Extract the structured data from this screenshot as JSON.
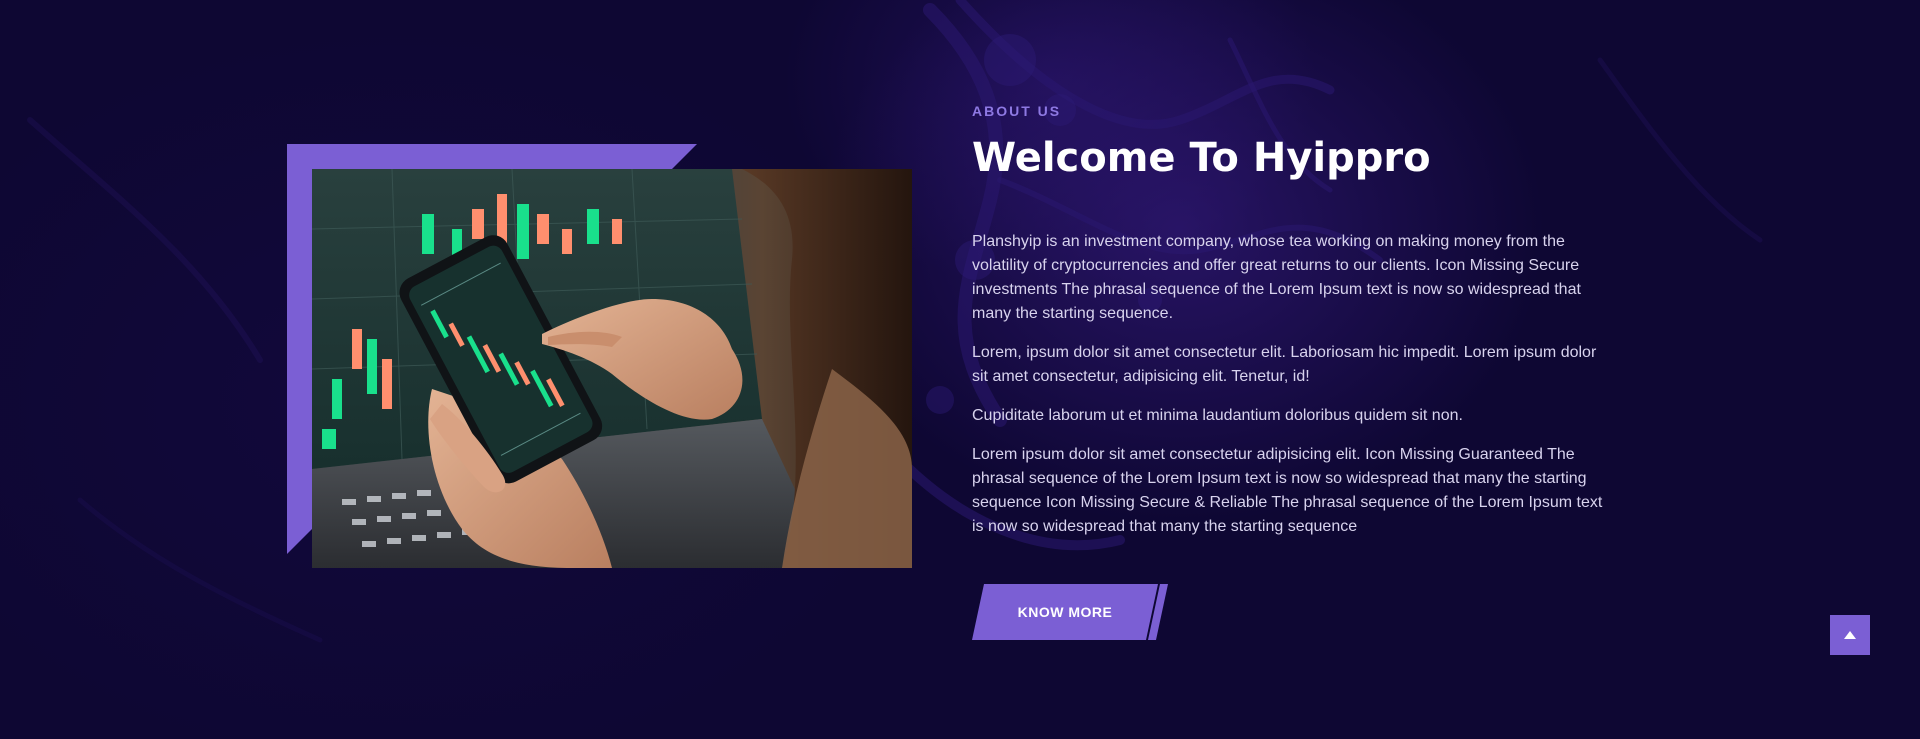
{
  "about": {
    "eyebrow": "ABOUT US",
    "title": "Welcome To Hyippro",
    "paragraphs": [
      "Planshyip is an investment company, whose tea working on making money from the volatility of cryptocurrencies and offer great returns to our clients. Icon Missing Secure investments The phrasal sequence of the Lorem Ipsum text is now so widespread that many the starting sequence.",
      "Lorem, ipsum dolor sit amet consectetur elit. Laboriosam hic impedit. Lorem ipsum dolor sit amet consectetur, adipisicing elit. Tenetur, id!",
      "Cupiditate laborum ut et minima laudantium doloribus quidem sit non.",
      "Lorem ipsum dolor sit amet consectetur adipisicing elit. Icon Missing Guaranteed The phrasal sequence of the Lorem Ipsum text is now so widespread that many the starting sequence Icon Missing Secure & Reliable The phrasal sequence of the Lorem Ipsum text is now so widespread that many the starting sequence"
    ],
    "button_label": "KNOW MORE"
  },
  "photo": {
    "icon": "trading-phone-photo"
  },
  "scroll_top": {
    "icon": "arrow-up-icon"
  },
  "colors": {
    "background": "#0e0733",
    "accent": "#7b5fd4",
    "eyebrow": "#8e79e3",
    "text": "#d8d3ee",
    "heading": "#ffffff"
  }
}
